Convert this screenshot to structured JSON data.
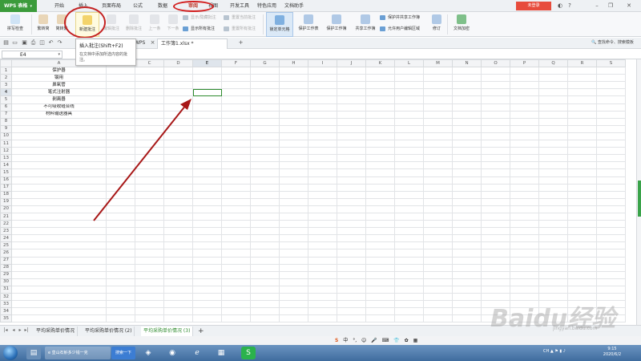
{
  "app": {
    "logo": "WPS 表格",
    "login": "未登录"
  },
  "menu": [
    "开始",
    "插入",
    "页面布局",
    "公式",
    "数据",
    "审阅",
    "视图",
    "开发工具",
    "特色应用",
    "文档助手"
  ],
  "window_controls": [
    "minimize-icon",
    "restore-icon",
    "close-icon"
  ],
  "ribbon": {
    "spell_check": "拼写检查",
    "trad_to_simp": "繁转简",
    "simp_to_trad": "简转繁",
    "new_comment": "新建批注",
    "edit_comment": "编辑批注",
    "delete_comment": "删除批注",
    "prev": "上一条",
    "next": "下一条",
    "show_hide_comment": "显示/隐藏批注",
    "reset_current_comment": "重置当前批注",
    "show_all_comments": "显示所有批注",
    "reset_all_comments": "重置所有批注",
    "lock_cell": "锁定单元格",
    "protect_sheet": "保护工作表",
    "protect_workbook": "保护工作簿",
    "share_workbook": "共享工作簿",
    "protect_share_workbook": "保护并共享工作簿",
    "allow_edit_ranges": "允许用户编辑区域",
    "revise": "修订",
    "doc_encrypt": "文档加密"
  },
  "tooltip": {
    "title": "插入批注(Shift+F2)",
    "desc": "在文档中添加所选内容的批注。"
  },
  "doc_tabs": {
    "wps": "WPS",
    "workbook": "工作簿1.xlsx *",
    "add": "+"
  },
  "search_cmd": "查找命令、搜索模板",
  "formula": {
    "cell_ref": "E4"
  },
  "grid": {
    "columns": [
      "A",
      "B",
      "C",
      "D",
      "E",
      "F",
      "G",
      "H",
      "I",
      "J",
      "K",
      "L",
      "M",
      "N",
      "O",
      "P",
      "Q",
      "R",
      "S"
    ],
    "rows": 35,
    "selected": "E4",
    "cells_A": [
      "保护器",
      "镊用",
      "鼻氧管",
      "笔式注射器",
      "剥离器",
      "不可吸收缝合线",
      "材料输送器具"
    ]
  },
  "sheets": [
    "平均采购单价情况",
    "平均采购单价情况 (2)",
    "平均采购单价情况 (3)"
  ],
  "active_sheet": 2,
  "ime": [
    "S",
    "中",
    "°,",
    "☺",
    "🎤",
    "⌨",
    "👕",
    "✿",
    "▦"
  ],
  "watermark": "Baidu经验",
  "watermark_sub": "jingyan.baidu.com",
  "taskbar": {
    "browser_task": "皇山石斛多少钱一克",
    "search_btn": "搜索一下",
    "clock_time": "9:15",
    "clock_date": "2020/6/2",
    "tray": "CH"
  }
}
